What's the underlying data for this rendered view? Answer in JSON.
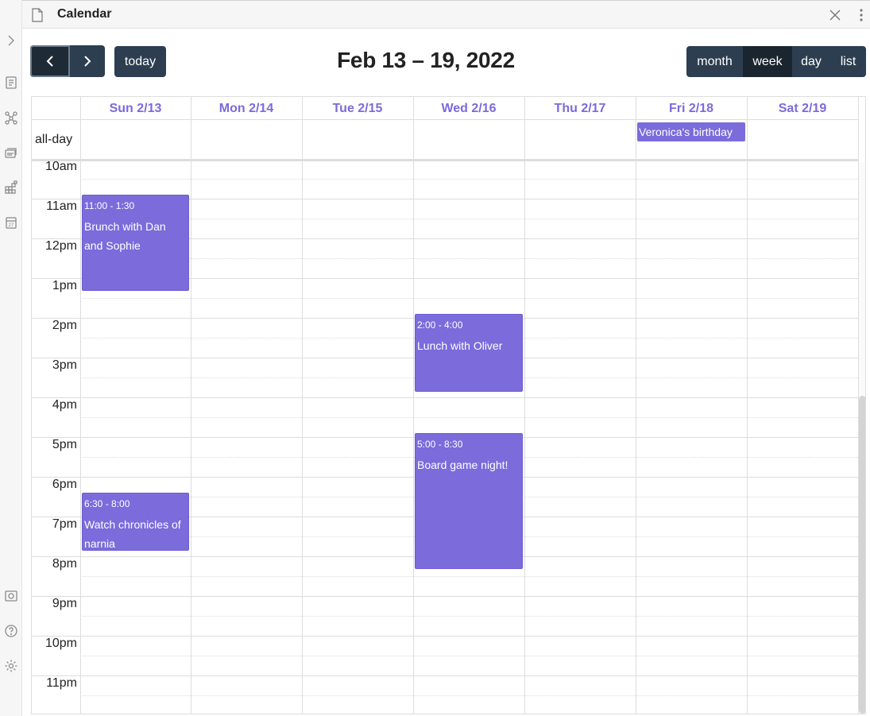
{
  "tab": {
    "title": "Calendar"
  },
  "toolbar": {
    "today_label": "today",
    "range_title": "Feb 13 – 19, 2022",
    "views": [
      "month",
      "week",
      "day",
      "list"
    ],
    "active_view": "week"
  },
  "days": [
    "Sun 2/13",
    "Mon 2/14",
    "Tue 2/15",
    "Wed 2/16",
    "Thu 2/17",
    "Fri 2/18",
    "Sat 2/19"
  ],
  "allday": {
    "label": "all-day",
    "events": [
      {
        "day": "Fri 2/18",
        "title": "Veronica's birthday"
      }
    ]
  },
  "times": [
    "10am",
    "11am",
    "12pm",
    "1pm",
    "2pm",
    "3pm",
    "4pm",
    "5pm",
    "6pm",
    "7pm",
    "8pm",
    "9pm",
    "10pm",
    "11pm"
  ],
  "events": [
    {
      "day": "Sun 2/13",
      "time": "11:00 - 1:30",
      "title": "Brunch with Dan and Sophie"
    },
    {
      "day": "Wed 2/16",
      "time": "2:00 - 4:00",
      "title": "Lunch with Oliver"
    },
    {
      "day": "Wed 2/16",
      "time": "5:00 - 8:30",
      "title": "Board game night!"
    },
    {
      "day": "Sun 2/13",
      "time": "6:30 - 8:00",
      "title": "Watch chronicles of narnia"
    }
  ],
  "colors": {
    "accent": "#7b6bdb",
    "button": "#2c3e50",
    "button_active": "#1a252f"
  },
  "ribbon_icons": [
    "chevron-right-icon",
    "file-list-icon",
    "graph-icon",
    "cards-icon",
    "grid-icon",
    "calendar-icon",
    "vault-icon",
    "help-icon",
    "settings-icon"
  ]
}
